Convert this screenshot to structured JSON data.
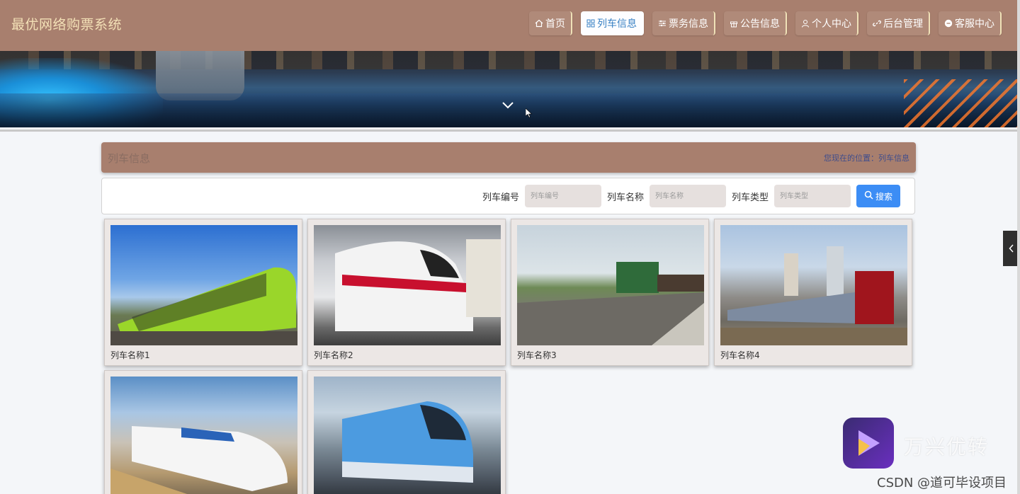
{
  "site": {
    "title": "最优网络购票系统"
  },
  "nav": {
    "items": [
      {
        "label": "首页",
        "icon": "home-icon"
      },
      {
        "label": "列车信息",
        "icon": "grid-icon",
        "active": true
      },
      {
        "label": "票务信息",
        "icon": "sliders-icon"
      },
      {
        "label": "公告信息",
        "icon": "gift-icon"
      },
      {
        "label": "个人中心",
        "icon": "user-icon"
      },
      {
        "label": "后台管理",
        "icon": "link-icon"
      },
      {
        "label": "客服中心",
        "icon": "chat-icon"
      }
    ]
  },
  "page": {
    "title": "列车信息",
    "breadcrumb": "您现在的位置：列车信息"
  },
  "search": {
    "fields": [
      {
        "label": "列车编号",
        "placeholder": "列车编号"
      },
      {
        "label": "列车名称",
        "placeholder": "列车名称"
      },
      {
        "label": "列车类型",
        "placeholder": "列车类型"
      }
    ],
    "button_label": "搜索"
  },
  "trains": [
    {
      "name": "列车名称1"
    },
    {
      "name": "列车名称2"
    },
    {
      "name": "列车名称3"
    },
    {
      "name": "列车名称4"
    },
    {
      "name": ""
    },
    {
      "name": ""
    }
  ],
  "watermark": {
    "app_name": "万兴优转",
    "source": "CSDN @道可毕设项目"
  },
  "colors": {
    "header_bg": "#a87f6e",
    "title_gold": "#f3e0b6",
    "active_nav_text": "#3b82c4",
    "search_button": "#3c8df5"
  }
}
